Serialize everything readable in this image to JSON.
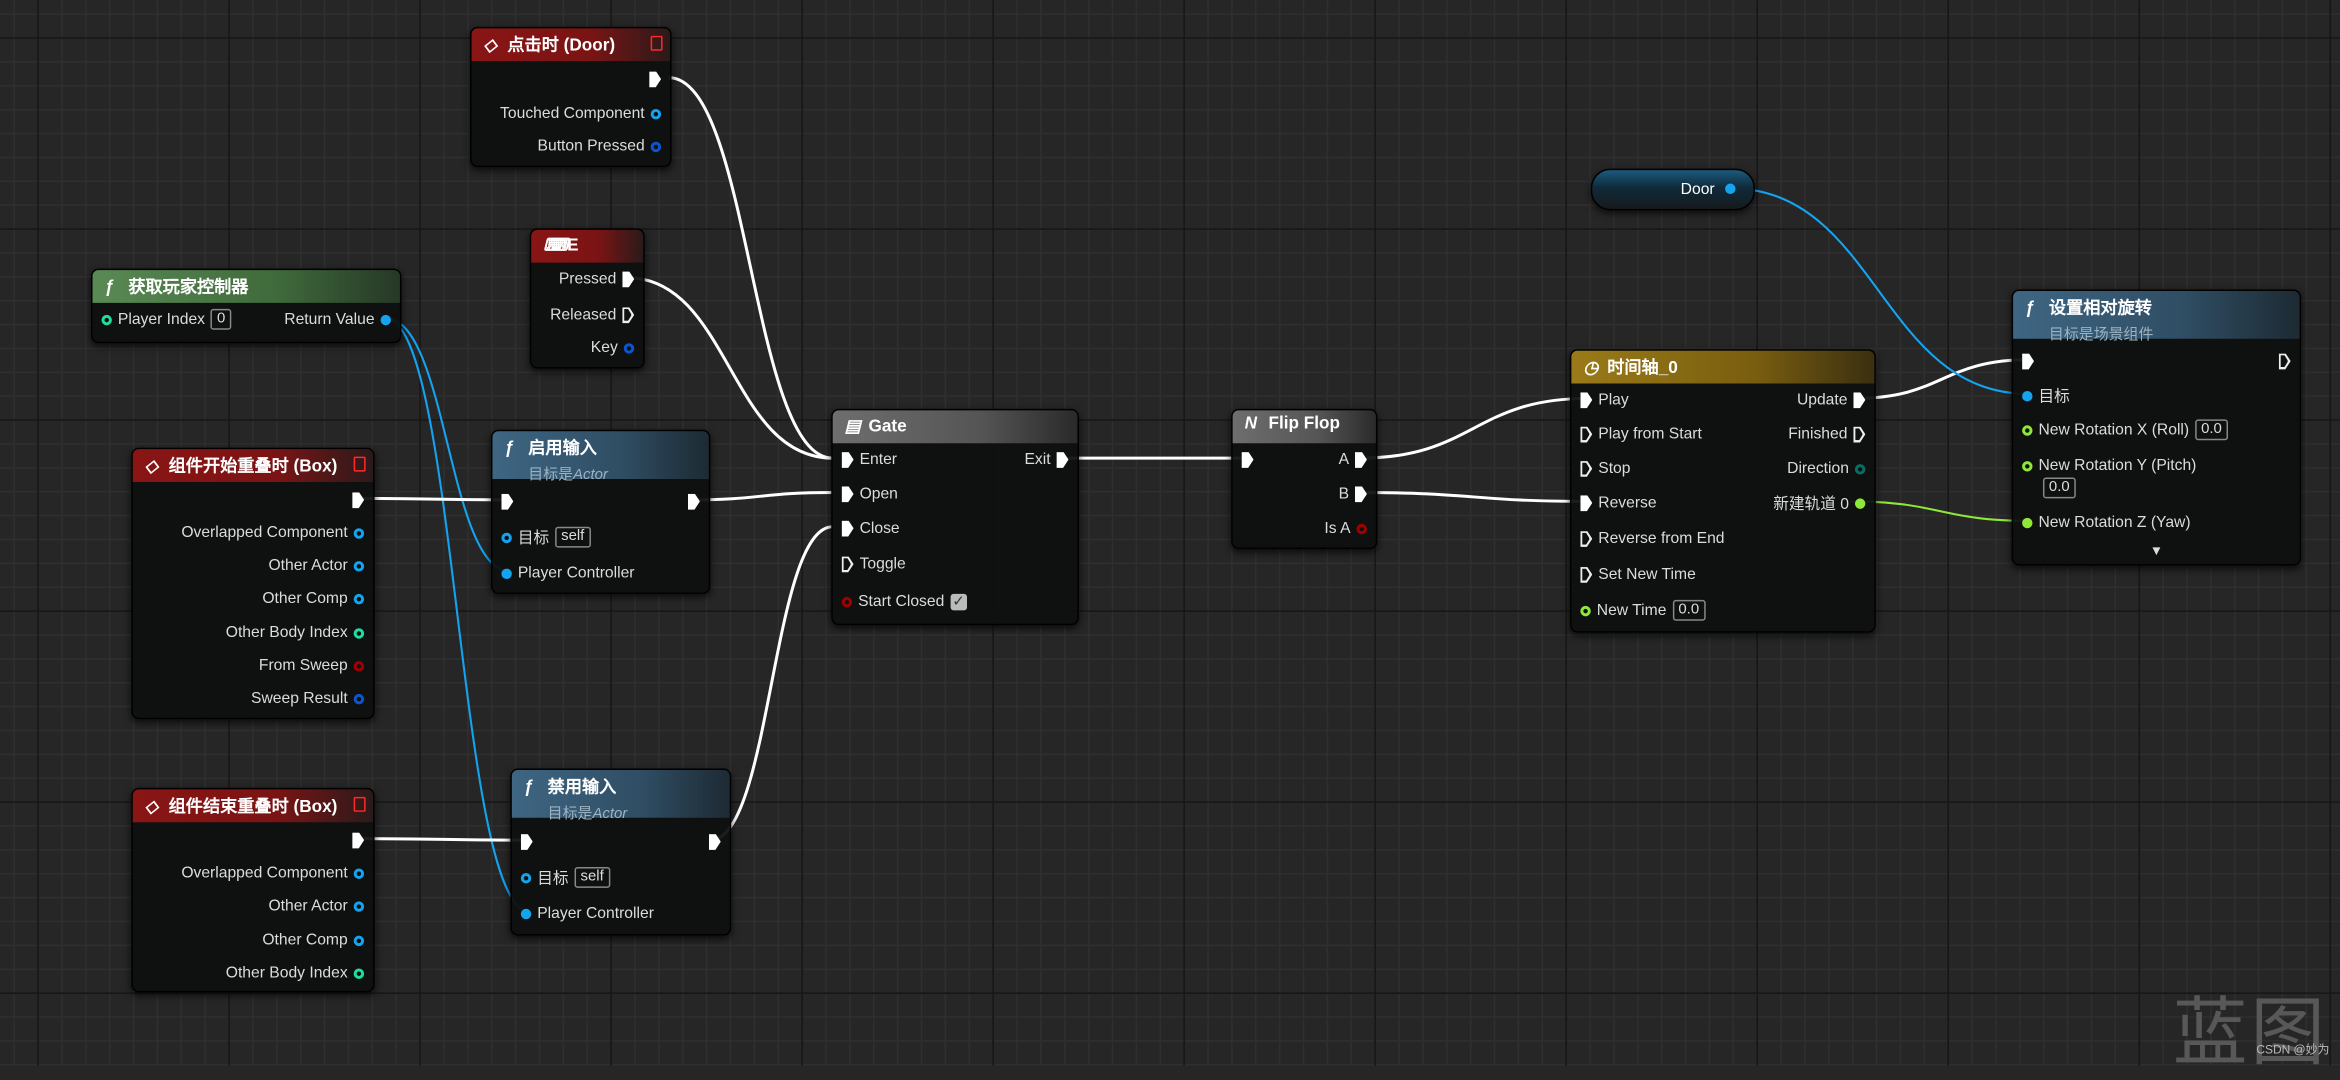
{
  "colors": {
    "exec": "#ffffff",
    "object": "#13a3ef",
    "int": "#1fdca0",
    "bool": "#a00000",
    "struct": "#0a56d0",
    "float": "#8de83a",
    "byte": "#0a6d64",
    "event_header": "#8a1515",
    "function_header": "#3a5f7a",
    "pure_function_header": "#4f7a4a",
    "macro_header": "#5a5a5a",
    "timeline_header": "#8a6a12"
  },
  "nodes": {
    "click_door": {
      "title": "点击时 (Door)",
      "icon": "event-icon",
      "kind": "event",
      "rows": [
        {
          "out": {
            "type": "exec"
          }
        },
        {
          "out": {
            "label": "Touched Component",
            "type": "object"
          }
        },
        {
          "out": {
            "label": "Button Pressed",
            "type": "struct"
          }
        }
      ]
    },
    "key_e": {
      "title": "E",
      "icon": "keyboard-icon",
      "kind": "event",
      "rows": [
        {
          "out": {
            "label": "Pressed",
            "type": "exec"
          }
        },
        {
          "out": {
            "label": "Released",
            "type": "exec",
            "hollow": true
          }
        },
        {
          "out": {
            "label": "Key",
            "type": "struct"
          }
        }
      ]
    },
    "get_player_controller": {
      "title": "获取玩家控制器",
      "icon": "function-icon",
      "kind": "pure",
      "rows": [
        {
          "in": {
            "label": "Player Index",
            "type": "int",
            "value": "0"
          },
          "out": {
            "label": "Return Value",
            "type": "object",
            "filled": true
          }
        }
      ]
    },
    "begin_overlap": {
      "title": "组件开始重叠时 (Box)",
      "icon": "event-icon",
      "kind": "event",
      "rows": [
        {
          "out": {
            "type": "exec"
          }
        },
        {
          "out": {
            "label": "Overlapped Component",
            "type": "object"
          }
        },
        {
          "out": {
            "label": "Other Actor",
            "type": "object"
          }
        },
        {
          "out": {
            "label": "Other Comp",
            "type": "object"
          }
        },
        {
          "out": {
            "label": "Other Body Index",
            "type": "int"
          }
        },
        {
          "out": {
            "label": "From Sweep",
            "type": "bool"
          }
        },
        {
          "out": {
            "label": "Sweep Result",
            "type": "struct"
          }
        }
      ]
    },
    "enable_input": {
      "title": "启用输入",
      "subtitle_prefix": "目标是",
      "subtitle_target": "Actor",
      "icon": "function-icon",
      "kind": "function",
      "rows": [
        {
          "in": {
            "type": "exec"
          },
          "out": {
            "type": "exec"
          }
        },
        {
          "in": {
            "label": "目标",
            "type": "object",
            "value": "self"
          }
        },
        {
          "in": {
            "label": "Player Controller",
            "type": "object",
            "filled": true
          }
        }
      ]
    },
    "end_overlap": {
      "title": "组件结束重叠时 (Box)",
      "icon": "event-icon",
      "kind": "event",
      "rows": [
        {
          "out": {
            "type": "exec"
          }
        },
        {
          "out": {
            "label": "Overlapped Component",
            "type": "object"
          }
        },
        {
          "out": {
            "label": "Other Actor",
            "type": "object"
          }
        },
        {
          "out": {
            "label": "Other Comp",
            "type": "object"
          }
        },
        {
          "out": {
            "label": "Other Body Index",
            "type": "int"
          }
        }
      ]
    },
    "disable_input": {
      "title": "禁用输入",
      "subtitle_prefix": "目标是",
      "subtitle_target": "Actor",
      "icon": "function-icon",
      "kind": "function",
      "rows": [
        {
          "in": {
            "type": "exec"
          },
          "out": {
            "type": "exec"
          }
        },
        {
          "in": {
            "label": "目标",
            "type": "object",
            "value": "self"
          }
        },
        {
          "in": {
            "label": "Player Controller",
            "type": "object",
            "filled": true
          }
        }
      ]
    },
    "gate": {
      "title": "Gate",
      "icon": "gate-icon",
      "kind": "macro",
      "rows": [
        {
          "in": {
            "label": "Enter",
            "type": "exec"
          },
          "out": {
            "label": "Exit",
            "type": "exec"
          }
        },
        {
          "in": {
            "label": "Open",
            "type": "exec"
          }
        },
        {
          "in": {
            "label": "Close",
            "type": "exec"
          }
        },
        {
          "in": {
            "label": "Toggle",
            "type": "exec",
            "hollow": true
          }
        },
        {
          "in": {
            "label": "Start Closed",
            "type": "bool",
            "checked": true
          }
        }
      ]
    },
    "flip_flop": {
      "title": "Flip Flop",
      "icon": "flipflop-icon",
      "kind": "macro",
      "rows": [
        {
          "in": {
            "type": "exec"
          },
          "out": {
            "label": "A",
            "type": "exec"
          }
        },
        {
          "out": {
            "label": "B",
            "type": "exec"
          }
        },
        {
          "out": {
            "label": "Is A",
            "type": "bool"
          }
        }
      ]
    },
    "timeline": {
      "title": "时间轴_0",
      "icon": "clock-icon",
      "kind": "timeline",
      "rows": [
        {
          "in": {
            "label": "Play",
            "type": "exec"
          },
          "out": {
            "label": "Update",
            "type": "exec"
          }
        },
        {
          "in": {
            "label": "Play from Start",
            "type": "exec",
            "hollow": true
          },
          "out": {
            "label": "Finished",
            "type": "exec",
            "hollow": true
          }
        },
        {
          "in": {
            "label": "Stop",
            "type": "exec",
            "hollow": true
          },
          "out": {
            "label": "Direction",
            "type": "byte"
          }
        },
        {
          "in": {
            "label": "Reverse",
            "type": "exec"
          },
          "out": {
            "label": "新建轨道 0",
            "type": "float",
            "filled": true
          }
        },
        {
          "in": {
            "label": "Reverse from End",
            "type": "exec",
            "hollow": true
          }
        },
        {
          "in": {
            "label": "Set New Time",
            "type": "exec",
            "hollow": true
          }
        },
        {
          "in": {
            "label": "New Time",
            "type": "float",
            "value": "0.0"
          }
        }
      ]
    },
    "set_relative_rotation": {
      "title": "设置相对旋转",
      "subtitle_prefix": "目标是场景组件",
      "subtitle_target": "",
      "icon": "function-icon",
      "kind": "function",
      "rows": [
        {
          "in": {
            "type": "exec"
          },
          "out": {
            "type": "exec",
            "hollow": true
          }
        },
        {
          "in": {
            "label": "目标",
            "type": "object",
            "filled": true
          }
        },
        {
          "in": {
            "label": "New Rotation X (Roll)",
            "type": "float",
            "value": "0.0"
          }
        },
        {
          "in": {
            "label": "New Rotation Y (Pitch)",
            "type": "float",
            "value": "0.0",
            "value_below": true
          }
        },
        {
          "in": {
            "label": "New Rotation Z (Yaw)",
            "type": "float",
            "filled": true
          }
        }
      ],
      "expand_icon": "chevron-down-icon"
    }
  },
  "variable_door": {
    "label": "Door",
    "type": "object"
  },
  "watermark": {
    "text": "蓝图",
    "credit": "CSDN @妙为"
  }
}
